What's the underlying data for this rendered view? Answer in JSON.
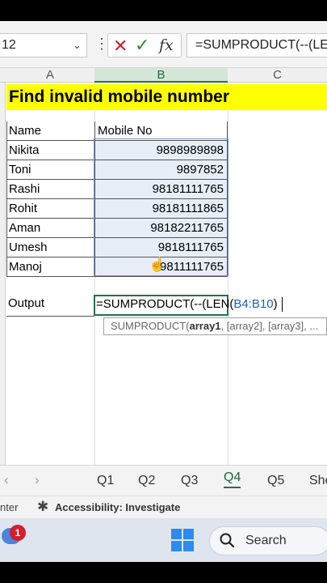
{
  "formula_bar": {
    "name_box": "12",
    "formula": "=SUMPRODUCT(--(LEN"
  },
  "columns": [
    "A",
    "B",
    "C"
  ],
  "sheet": {
    "title": "Find invalid mobile number",
    "header": {
      "name": "Name",
      "mobile": "Mobile No"
    },
    "rows": [
      {
        "name": "Nikita",
        "mobile": "9898989898"
      },
      {
        "name": "Toni",
        "mobile": "9897852"
      },
      {
        "name": "Rashi",
        "mobile": "98181111765"
      },
      {
        "name": "Rohit",
        "mobile": "98181111865"
      },
      {
        "name": "Aman",
        "mobile": "98182211765"
      },
      {
        "name": "Umesh",
        "mobile": "9818111765"
      },
      {
        "name": "Manoj",
        "mobile": "9811111765"
      }
    ],
    "output_label": "Output",
    "edit_text_prefix": "=SUMPRODUCT(--(LEN(",
    "edit_text_ref": "B4:B10",
    "edit_text_suffix": ")",
    "tooltip_fn": "SUMPRODUCT(",
    "tooltip_arg1": "array1",
    "tooltip_rest": ", [array2], [array3], ..."
  },
  "sheet_tabs": {
    "tabs": [
      "Q1",
      "Q2",
      "Q3",
      "Q4",
      "Q5",
      "She"
    ],
    "active": "Q4"
  },
  "status_bar": {
    "left_text": "nter",
    "accessibility": "Accessibility: Investigate"
  },
  "taskbar": {
    "notification_count": "1",
    "search_label": "Search"
  },
  "colors": {
    "title_fill": "#ffff00",
    "selection_fill": "#e7eef7",
    "excel_green": "#217346",
    "windows_blue": "#2c8bf0"
  }
}
